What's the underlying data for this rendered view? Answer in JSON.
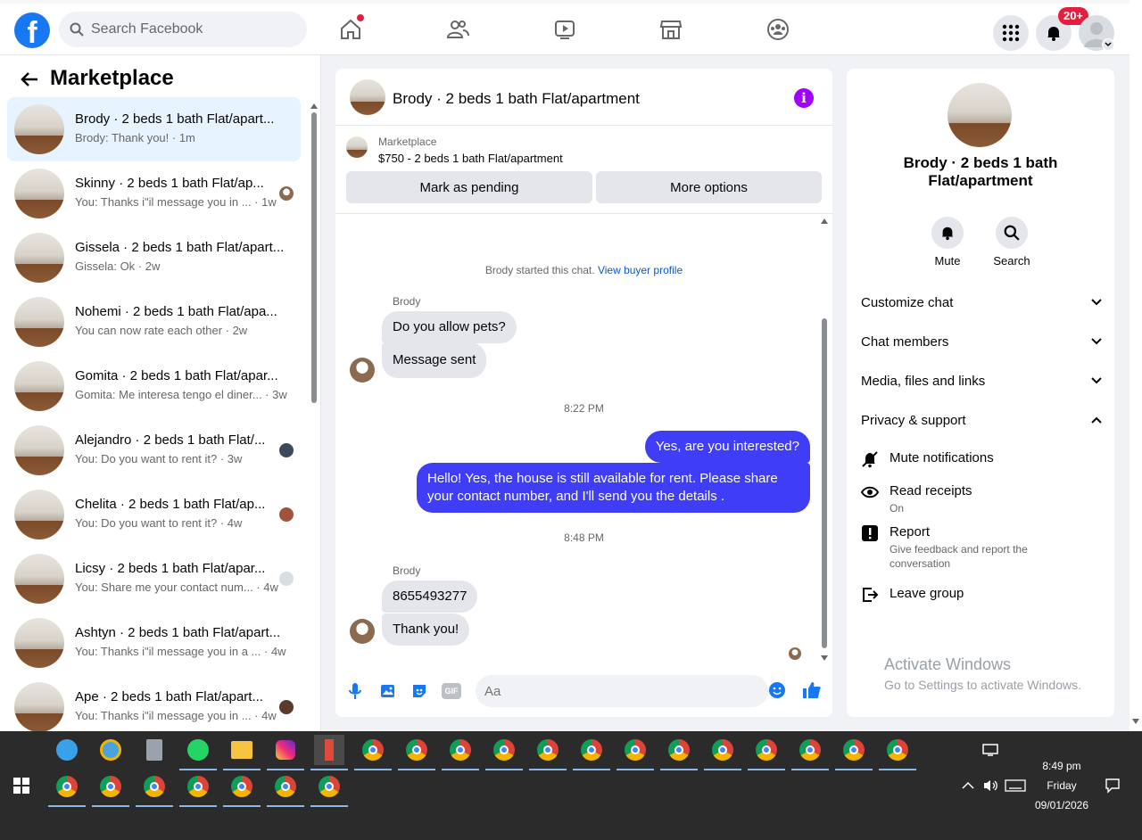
{
  "topbar": {
    "search_placeholder": "Search Facebook",
    "notification_badge": "20+"
  },
  "marketplace": {
    "title": "Marketplace",
    "conversations": [
      {
        "title": "Brody · 2 beds 1 bath Flat/apart...",
        "preview": "Brody: Thank you! · 1m",
        "active": true
      },
      {
        "title": "Skinny · 2 beds 1 bath Flat/ap...",
        "preview": "You: Thanks i\"il message you in ... · 1w"
      },
      {
        "title": "Gissela · 2 beds 1 bath Flat/apart...",
        "preview": "Gissela: Ok · 2w"
      },
      {
        "title": "Nohemi · 2 beds 1 bath Flat/apa...",
        "preview": "You can now rate each other · 2w"
      },
      {
        "title": "Gomita · 2 beds 1 bath Flat/apar...",
        "preview": "Gomita: Me interesa tengo el diner... · 3w"
      },
      {
        "title": "Alejandro · 2 beds 1 bath Flat/...",
        "preview": "You: Do you want to rent it? · 3w"
      },
      {
        "title": "Chelita · 2 beds 1 bath Flat/ap...",
        "preview": "You: Do you want to rent it? · 4w"
      },
      {
        "title": "Licsy · 2 beds 1 bath Flat/apar...",
        "preview": "You: Share me your contact num... · 4w"
      },
      {
        "title": "Ashtyn · 2 beds 1 bath Flat/apart...",
        "preview": "You: Thanks i\"il message you in a ... · 4w"
      },
      {
        "title": "Ape · 2 beds 1 bath Flat/apart...",
        "preview": "You: Thanks i\"il message you in ... · 4w"
      }
    ]
  },
  "chat": {
    "title": "Brody · 2 beds 1 bath Flat/apartment",
    "listing_label": "Marketplace",
    "listing_detail": "$750 - 2 beds 1 bath Flat/apartment",
    "mark_pending": "Mark as pending",
    "more_options": "More options",
    "started_text": "Brody started this chat.",
    "view_profile": "View buyer profile",
    "sender_1": "Brody",
    "msg_pets": "Do you allow pets?",
    "msg_sent": "Message sent",
    "time_1": "8:22 PM",
    "msg_interested": "Yes, are you interested?",
    "msg_available": "Hello! Yes, the house is still available for rent. Please share your contact number, and I'll send you the details .",
    "time_2": "8:48 PM",
    "sender_2": "Brody",
    "msg_number": "8655493277",
    "msg_thanks": "Thank you!",
    "input_placeholder": "Aa"
  },
  "details": {
    "name": "Brody · 2 beds 1 bath Flat/apartment",
    "mute": "Mute",
    "search": "Search",
    "customize_chat": "Customize chat",
    "chat_members": "Chat members",
    "media_files": "Media, files and links",
    "privacy_support": "Privacy & support",
    "mute_notifications": "Mute notifications",
    "read_receipts": "Read receipts",
    "read_receipts_state": "On",
    "report": "Report",
    "report_sub": "Give feedback and report the conversation",
    "leave_group": "Leave group"
  },
  "watermark": {
    "line1": "Activate Windows",
    "line2": "Go to Settings to activate Windows."
  },
  "taskbar": {
    "time": "8:49 pm",
    "day": "Friday",
    "date": "09/01/2026"
  },
  "colors": {
    "brand": "#1877f2",
    "outgoing_bubble": "#3f3df5",
    "info_icon": "#a100ff",
    "badge": "#e41e3f"
  }
}
